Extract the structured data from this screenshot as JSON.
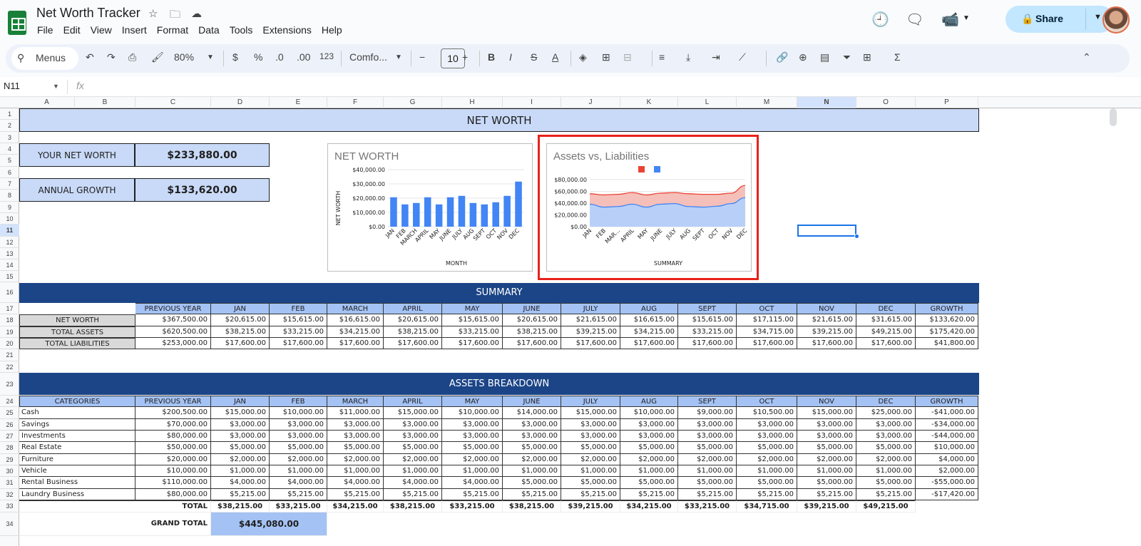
{
  "app": {
    "title": "Net Worth Tracker",
    "share_label": "Share",
    "menus": [
      "File",
      "Edit",
      "View",
      "Insert",
      "Format",
      "Data",
      "Tools",
      "Extensions",
      "Help"
    ]
  },
  "toolbar": {
    "search_label": "Menus",
    "zoom": "80%",
    "currency": "$",
    "percent": "%",
    "dec_dec": ".0",
    "inc_dec": ".00",
    "num_format": "123",
    "font": "Comfo...",
    "font_size": "10",
    "bold": "B",
    "italic": "I",
    "strike": "S",
    "text_color": "A"
  },
  "formula": {
    "cell_ref": "N11",
    "fx": "fx"
  },
  "columns": [
    "A",
    "B",
    "C",
    "D",
    "E",
    "F",
    "G",
    "H",
    "I",
    "J",
    "K",
    "L",
    "M",
    "N",
    "O",
    "P"
  ],
  "rows": [
    "1",
    "2",
    "3",
    "4",
    "5",
    "6",
    "7",
    "8",
    "9",
    "10",
    "11",
    "12",
    "13",
    "14",
    "15",
    "16",
    "17",
    "18",
    "19",
    "20",
    "21",
    "22",
    "23",
    "24",
    "25",
    "26",
    "27",
    "28",
    "29",
    "30",
    "31",
    "32",
    "33",
    "34"
  ],
  "banner": {
    "net_worth": "NET WORTH",
    "summary": "SUMMARY",
    "assets": "ASSETS BREAKDOWN"
  },
  "kpis": {
    "net_label": "YOUR NET WORTH",
    "net_value": "$233,880.00",
    "growth_label": "ANNUAL GROWTH",
    "growth_value": "$133,620.00"
  },
  "summary": {
    "headers": [
      "PREVIOUS YEAR",
      "JAN",
      "FEB",
      "MARCH",
      "APRIL",
      "MAY",
      "JUNE",
      "JULY",
      "AUG",
      "SEPT",
      "OCT",
      "NOV",
      "DEC",
      "GROWTH"
    ],
    "rows": [
      {
        "label": "NET WORTH",
        "cells": [
          "$367,500.00",
          "$20,615.00",
          "$15,615.00",
          "$16,615.00",
          "$20,615.00",
          "$15,615.00",
          "$20,615.00",
          "$21,615.00",
          "$16,615.00",
          "$15,615.00",
          "$17,115.00",
          "$21,615.00",
          "$31,615.00",
          "$133,620.00"
        ]
      },
      {
        "label": "TOTAL ASSETS",
        "cells": [
          "$620,500.00",
          "$38,215.00",
          "$33,215.00",
          "$34,215.00",
          "$38,215.00",
          "$33,215.00",
          "$38,215.00",
          "$39,215.00",
          "$34,215.00",
          "$33,215.00",
          "$34,715.00",
          "$39,215.00",
          "$49,215.00",
          "$175,420.00"
        ]
      },
      {
        "label": "TOTAL LIABILITIES",
        "cells": [
          "$253,000.00",
          "$17,600.00",
          "$17,600.00",
          "$17,600.00",
          "$17,600.00",
          "$17,600.00",
          "$17,600.00",
          "$17,600.00",
          "$17,600.00",
          "$17,600.00",
          "$17,600.00",
          "$17,600.00",
          "$17,600.00",
          "$41,800.00"
        ]
      }
    ]
  },
  "assets": {
    "headers": [
      "CATEGORIES",
      "PREVIOUS YEAR",
      "JAN",
      "FEB",
      "MARCH",
      "APRIL",
      "MAY",
      "JUNE",
      "JULY",
      "AUG",
      "SEPT",
      "OCT",
      "NOV",
      "DEC",
      "GROWTH"
    ],
    "rows": [
      [
        "Cash",
        "$200,500.00",
        "$15,000.00",
        "$10,000.00",
        "$11,000.00",
        "$15,000.00",
        "$10,000.00",
        "$14,000.00",
        "$15,000.00",
        "$10,000.00",
        "$9,000.00",
        "$10,500.00",
        "$15,000.00",
        "$25,000.00",
        "-$41,000.00"
      ],
      [
        "Savings",
        "$70,000.00",
        "$3,000.00",
        "$3,000.00",
        "$3,000.00",
        "$3,000.00",
        "$3,000.00",
        "$3,000.00",
        "$3,000.00",
        "$3,000.00",
        "$3,000.00",
        "$3,000.00",
        "$3,000.00",
        "$3,000.00",
        "-$34,000.00"
      ],
      [
        "Investments",
        "$80,000.00",
        "$3,000.00",
        "$3,000.00",
        "$3,000.00",
        "$3,000.00",
        "$3,000.00",
        "$3,000.00",
        "$3,000.00",
        "$3,000.00",
        "$3,000.00",
        "$3,000.00",
        "$3,000.00",
        "$3,000.00",
        "-$44,000.00"
      ],
      [
        "Real Estate",
        "$50,000.00",
        "$5,000.00",
        "$5,000.00",
        "$5,000.00",
        "$5,000.00",
        "$5,000.00",
        "$5,000.00",
        "$5,000.00",
        "$5,000.00",
        "$5,000.00",
        "$5,000.00",
        "$5,000.00",
        "$5,000.00",
        "$10,000.00"
      ],
      [
        "Furniture",
        "$20,000.00",
        "$2,000.00",
        "$2,000.00",
        "$2,000.00",
        "$2,000.00",
        "$2,000.00",
        "$2,000.00",
        "$2,000.00",
        "$2,000.00",
        "$2,000.00",
        "$2,000.00",
        "$2,000.00",
        "$2,000.00",
        "$4,000.00"
      ],
      [
        "Vehicle",
        "$10,000.00",
        "$1,000.00",
        "$1,000.00",
        "$1,000.00",
        "$1,000.00",
        "$1,000.00",
        "$1,000.00",
        "$1,000.00",
        "$1,000.00",
        "$1,000.00",
        "$1,000.00",
        "$1,000.00",
        "$1,000.00",
        "$2,000.00"
      ],
      [
        "Rental Business",
        "$110,000.00",
        "$4,000.00",
        "$4,000.00",
        "$4,000.00",
        "$4,000.00",
        "$4,000.00",
        "$5,000.00",
        "$5,000.00",
        "$5,000.00",
        "$5,000.00",
        "$5,000.00",
        "$5,000.00",
        "$5,000.00",
        "-$55,000.00"
      ],
      [
        "Laundry Business",
        "$80,000.00",
        "$5,215.00",
        "$5,215.00",
        "$5,215.00",
        "$5,215.00",
        "$5,215.00",
        "$5,215.00",
        "$5,215.00",
        "$5,215.00",
        "$5,215.00",
        "$5,215.00",
        "$5,215.00",
        "$5,215.00",
        "-$17,420.00"
      ]
    ],
    "total_label": "TOTAL",
    "totals": [
      "$38,215.00",
      "$33,215.00",
      "$34,215.00",
      "$38,215.00",
      "$33,215.00",
      "$38,215.00",
      "$39,215.00",
      "$34,215.00",
      "$33,215.00",
      "$34,715.00",
      "$39,215.00",
      "$49,215.00"
    ],
    "grand_label": "GRAND TOTAL",
    "grand_value": "$445,080.00"
  },
  "chart_data": [
    {
      "type": "bar",
      "title": "NET WORTH",
      "xlabel": "MONTH",
      "ylabel": "NET WORTH",
      "categories": [
        "JAN",
        "FEB",
        "MARCH",
        "APRIL",
        "MAY",
        "JUNE",
        "JULY",
        "AUG",
        "SEPT",
        "OCT",
        "NOV",
        "DEC"
      ],
      "values": [
        20615,
        15615,
        16615,
        20615,
        15615,
        20615,
        21615,
        16615,
        15615,
        17115,
        21615,
        31615
      ],
      "yticks": [
        "$40,000.00",
        "$30,000.00",
        "$20,000.00",
        "$10,000.00",
        "$0.00"
      ],
      "ylim": [
        0,
        40000
      ],
      "color": "#4285f4"
    },
    {
      "type": "area",
      "title": "Assets vs, Liabilities",
      "xlabel": "SUMMARY",
      "categories": [
        "JAN",
        "FEB",
        "MAR...",
        "APRIL",
        "MAY",
        "JUNE",
        "JULY",
        "AUG",
        "SEPT",
        "OCT",
        "NOV",
        "DEC"
      ],
      "series": [
        {
          "color": "#ea4335",
          "values": [
            56000,
            54000,
            55000,
            58000,
            54000,
            57000,
            58000,
            56000,
            55000,
            55000,
            57000,
            70000
          ]
        },
        {
          "color": "#4285f4",
          "values": [
            38215,
            33215,
            34215,
            38215,
            33215,
            38215,
            39215,
            34215,
            33215,
            34715,
            39215,
            49215
          ]
        }
      ],
      "yticks": [
        "$80,000.00",
        "$60,000.00",
        "$40,000.00",
        "$20,000.00",
        "$0.00"
      ],
      "ylim": [
        0,
        80000
      ]
    }
  ]
}
